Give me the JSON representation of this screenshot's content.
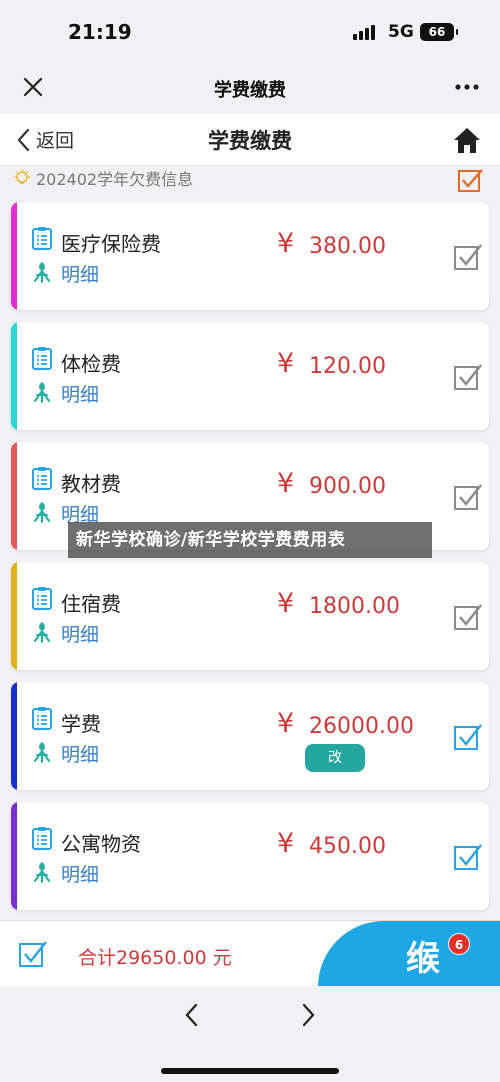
{
  "status": {
    "time": "21:19",
    "network": "5G",
    "battery": "66"
  },
  "wechat": {
    "title": "学费缴费"
  },
  "header": {
    "back_label": "返回",
    "title": "学费缴费"
  },
  "section": {
    "title": "202402学年欠费信息"
  },
  "items": [
    {
      "name": "医疗保险费",
      "detail": "明细",
      "currency": "¥",
      "amount": "380.00",
      "color": "#e02fd0",
      "checked_style": "gray"
    },
    {
      "name": "体检费",
      "detail": "明细",
      "currency": "¥",
      "amount": "120.00",
      "color": "#2fd6d6",
      "checked_style": "gray"
    },
    {
      "name": "教材费",
      "detail": "明细",
      "currency": "¥",
      "amount": "900.00",
      "color": "#e05a5a",
      "checked_style": "gray"
    },
    {
      "name": "住宿费",
      "detail": "明细",
      "currency": "¥",
      "amount": "1800.00",
      "color": "#e0b020",
      "checked_style": "gray"
    },
    {
      "name": "学费",
      "detail": "明细",
      "currency": "¥",
      "amount": "26000.00",
      "color": "#1a2fc8",
      "checked_style": "blue",
      "edit_label": "改"
    },
    {
      "name": "公寓物资",
      "detail": "明细",
      "currency": "¥",
      "amount": "450.00",
      "color": "#7a2fd0",
      "checked_style": "blue"
    }
  ],
  "watermark": "新华学校确诊/新华学校学费费用表",
  "footer": {
    "total": "合计29650.00 元",
    "logo_text": "缑",
    "badge_count": "6"
  },
  "colors": {
    "accent_red": "#cc3b3b",
    "link_blue": "#3b82c4",
    "check_blue": "#2aa3e0",
    "teal": "#26a6a0"
  }
}
